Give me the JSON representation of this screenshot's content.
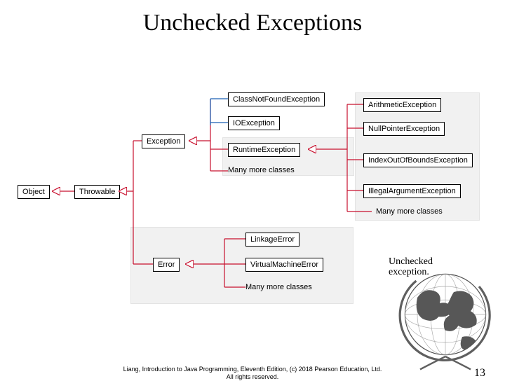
{
  "title": "Unchecked Exceptions",
  "nodes": {
    "object": "Object",
    "throwable": "Throwable",
    "exception": "Exception",
    "error": "Error",
    "classNotFound": "ClassNotFoundException",
    "io": "IOException",
    "runtime": "RuntimeException",
    "arithmetic": "ArithmeticException",
    "nullPointer": "NullPointerException",
    "indexOob": "IndexOutOfBoundsException",
    "illegalArg": "IllegalArgumentException",
    "linkage": "LinkageError",
    "vm": "VirtualMachineError",
    "more1": "Many more classes",
    "more2": "Many more classes",
    "more3": "Many more classes"
  },
  "caption": {
    "line1": "Unchecked",
    "line2": "exception."
  },
  "footer": {
    "line1": "Liang, Introduction to Java Programming, Eleventh Edition, (c) 2018 Pearson Education, Ltd.",
    "line2": "All rights reserved."
  },
  "pageNumber": "13",
  "colors": {
    "unchecked_line": "#c8102e",
    "checked_line": "#1a5fb4"
  }
}
